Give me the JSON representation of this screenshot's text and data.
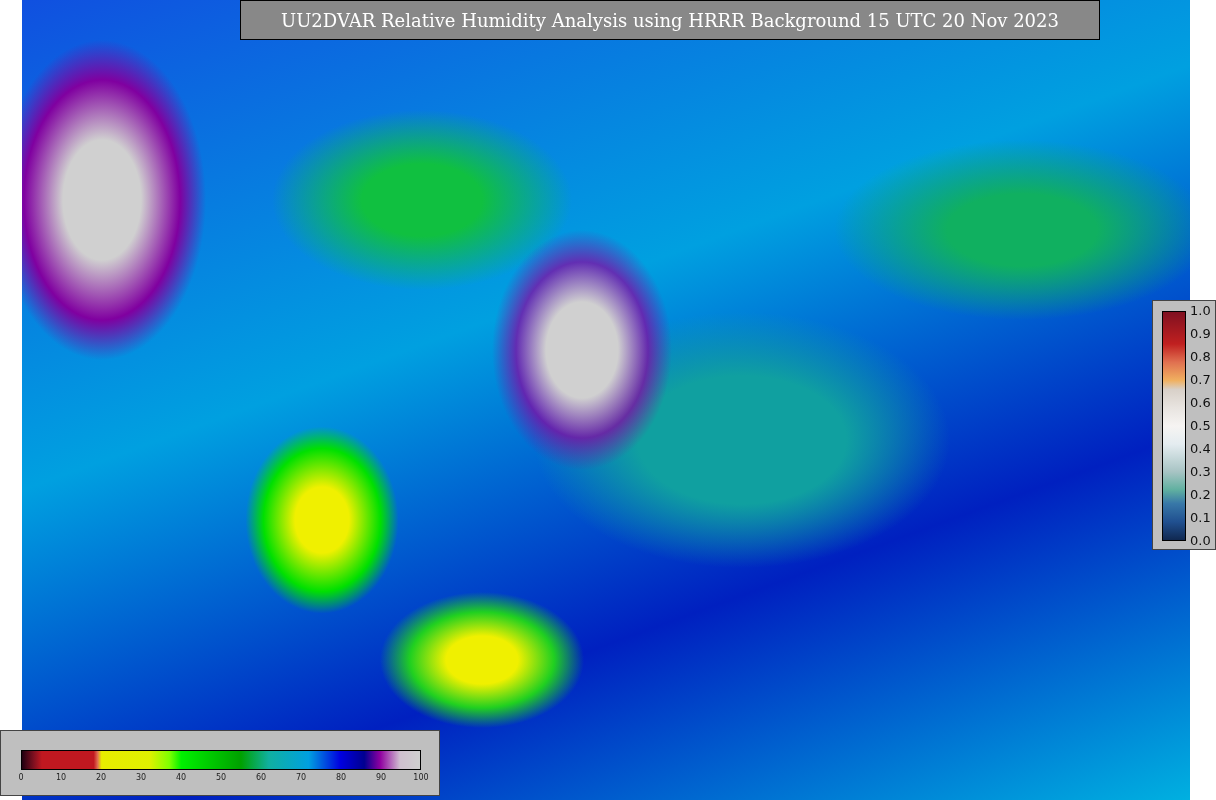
{
  "title": "UU2DVAR Relative Humidity Analysis using HRRR Background 15 UTC 20 Nov 2023",
  "humidity_colorbar": {
    "ticks": [
      "0",
      "10",
      "20",
      "30",
      "40",
      "50",
      "60",
      "70",
      "80",
      "90",
      "100"
    ]
  },
  "observation_colorbar": {
    "ticks": [
      "1.0",
      "0.9",
      "0.8",
      "0.7",
      "0.6",
      "0.5",
      "0.4",
      "0.3",
      "0.2",
      "0.1",
      "0.0"
    ]
  }
}
